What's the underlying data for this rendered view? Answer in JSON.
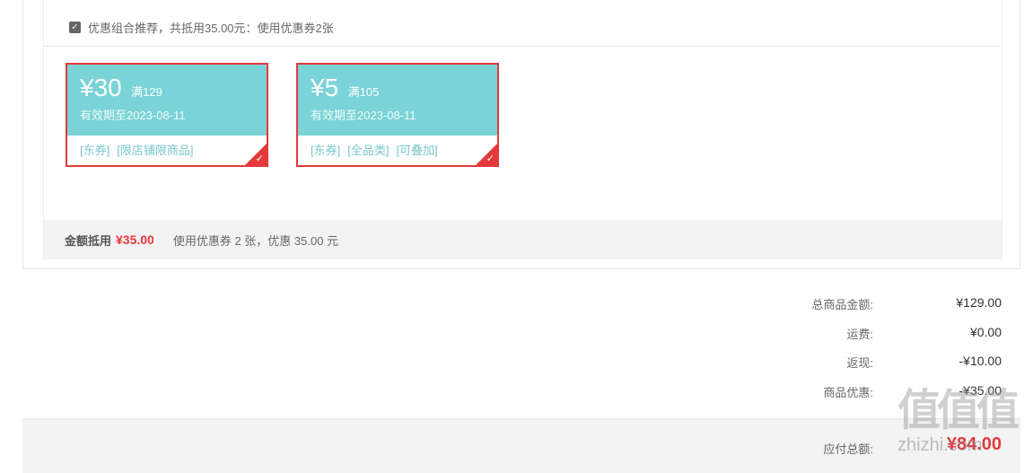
{
  "combo": {
    "checked": true,
    "text": "优惠组合推荐，共抵用35.00元：使用优惠券2张"
  },
  "coupons": [
    {
      "amount": "¥30",
      "condition": "满129",
      "expire": "有效期至2023-08-11",
      "tags": [
        "[东券]",
        "[限店铺限商品]"
      ]
    },
    {
      "amount": "¥5",
      "condition": "满105",
      "expire": "有效期至2023-08-11",
      "tags": [
        "[东券]",
        "[全品类]",
        "[可叠加]"
      ]
    }
  ],
  "summary": {
    "label": "金额抵用",
    "amount": "¥35.00",
    "desc": "使用优惠券 2 张，优惠 35.00 元"
  },
  "totals": [
    {
      "label": "总商品金额:",
      "value": "¥129.00"
    },
    {
      "label": "运费:",
      "value": "¥0.00"
    },
    {
      "label": "返现:",
      "value": "-¥10.00"
    },
    {
      "label": "商品优惠:",
      "value": "-¥35.00"
    }
  ],
  "payable": {
    "label": "应付总额:",
    "value": "¥84.00"
  },
  "watermark": {
    "glyphs": "值值值",
    "site": "zhizhi.com"
  },
  "colors": {
    "accent": "#e4393c",
    "coupon": "#79d3d7",
    "tag": "#79c7cc",
    "bar": "#f3f3f3"
  }
}
